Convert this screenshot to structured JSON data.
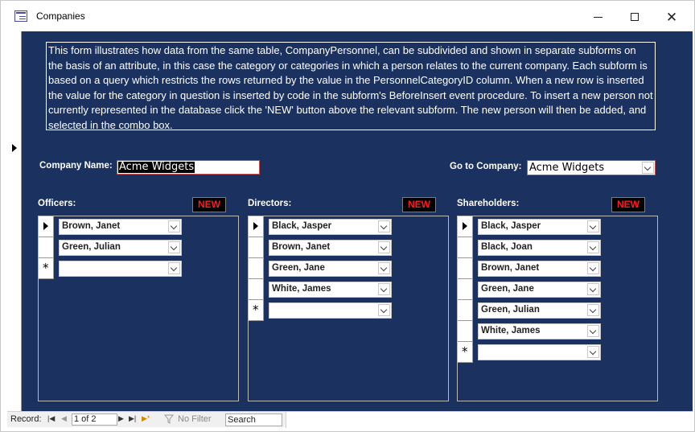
{
  "window": {
    "title": "Companies"
  },
  "form": {
    "description": "This form illustrates how data from the same table, CompanyPersonnel, can be subdivided and shown in separate subforms on the basis of an attribute, in this case the category or categories in which a person relates to the current company.  Each subform is based on a query which restricts the rows returned by the value in the PersonnelCategoryID column.  When a new row is inserted the value for the category in question is inserted by code in the subform's BeforeInsert event procedure.  To insert a new person not currently represented in the database click the 'NEW' button above the relevant subform.  The new person will then be added, and selected in the combo box.",
    "company_name_label": "Company Name:",
    "company_name_value": "Acme Widgets",
    "goto_label": "Go to Company:",
    "goto_value": "Acme Widgets"
  },
  "subforms": [
    {
      "label": "Officers:",
      "new_label": "NEW",
      "rows": [
        "Brown, Janet",
        "Green, Julian"
      ]
    },
    {
      "label": "Directors:",
      "new_label": "NEW",
      "rows": [
        "Black, Jasper",
        "Brown, Janet",
        "Green, Jane",
        "White, James"
      ]
    },
    {
      "label": "Shareholders:",
      "new_label": "NEW",
      "rows": [
        "Black, Jasper",
        "Black, Joan",
        "Brown, Janet",
        "Green, Jane",
        "Green, Julian",
        "White, James"
      ]
    }
  ],
  "navigation": {
    "record_label": "Record:",
    "position": "1 of 2",
    "filter_label": "No Filter",
    "search_placeholder": "Search"
  },
  "colors": {
    "form_background": "#1b3260",
    "new_button_text": "#ff1b1b",
    "field_border": "#c0504d"
  }
}
